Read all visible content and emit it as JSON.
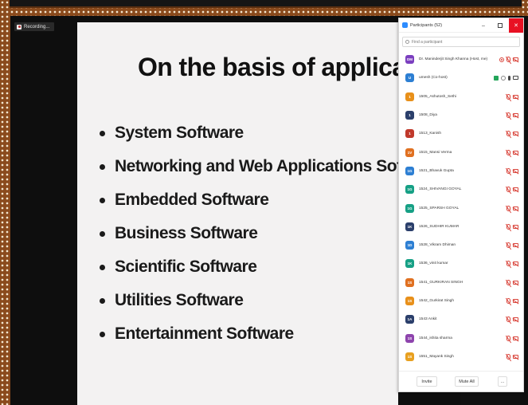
{
  "recording": {
    "label": "Recording..."
  },
  "slide": {
    "title": "On the basis of application",
    "bullets": [
      "System Software",
      "Networking and Web Applications Softw",
      "Embedded Software",
      "Business Software",
      "Scientific Software",
      "Utilities Software",
      "Entertainment Software"
    ]
  },
  "panel": {
    "title": "Participants (52)",
    "window_controls": {
      "minimize": "–",
      "close": "✕"
    },
    "search_placeholder": "Find a participant",
    "participants": [
      {
        "initials": "DM",
        "name": "Dr. Maninderjit Singh Khanna (Host, me)",
        "color": "#7b3fbf"
      },
      {
        "initials": "U",
        "name": "umesh (Co-host)",
        "color": "#2d7fd3"
      },
      {
        "initials": "1",
        "name": "1505_Ashutosh_Sethi",
        "color": "#e8901a"
      },
      {
        "initials": "1",
        "name": "1508_Diya",
        "color": "#2b3f6b"
      },
      {
        "initials": "1",
        "name": "1513_Kanish",
        "color": "#c0392b"
      },
      {
        "initials": "1V",
        "name": "1515_Mansi Verma",
        "color": "#e07020"
      },
      {
        "initials": "1G",
        "name": "1521_Bhavuk Gupta",
        "color": "#2d7fd3"
      },
      {
        "initials": "1G",
        "name": "1524_SHIVANGI GOYAL",
        "color": "#16a085"
      },
      {
        "initials": "1G",
        "name": "1525_SPARSH GOYAL",
        "color": "#16a085"
      },
      {
        "initials": "1K",
        "name": "1526_SUDHIR KUMAR",
        "color": "#2b3f6b"
      },
      {
        "initials": "1D",
        "name": "1528_Vikram Dhiman",
        "color": "#2d7fd3"
      },
      {
        "initials": "1K",
        "name": "1536_vinit kumar",
        "color": "#16a085"
      },
      {
        "initials": "1S",
        "name": "1541_GURKIRAN SINGH",
        "color": "#e07020"
      },
      {
        "initials": "1S",
        "name": "1542_Gurkirat Singh",
        "color": "#e8901a"
      },
      {
        "initials": "1A",
        "name": "1543 Ankit",
        "color": "#2b3f6b"
      },
      {
        "initials": "1S",
        "name": "1544_ishita sharma",
        "color": "#8e44ad"
      },
      {
        "initials": "1S",
        "name": "1551_Mayank Singh",
        "color": "#e8a020"
      }
    ],
    "footer": {
      "invite": "Invite",
      "mute_all": "Mute All",
      "more": "..."
    }
  }
}
